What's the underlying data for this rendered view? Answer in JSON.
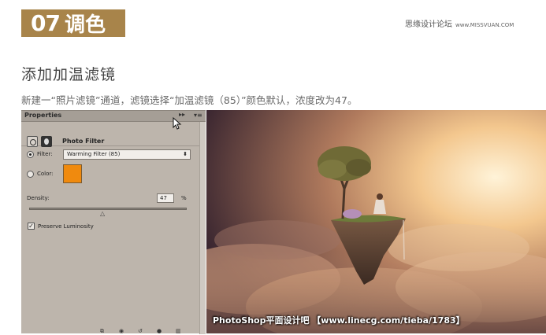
{
  "header": {
    "badge_number": "07",
    "badge_title": "调色",
    "site_name": "思缘设计论坛",
    "site_url": "www.MISSVUAN.COM",
    "badge_color": "#a8844a"
  },
  "section_title": "添加加温滤镜",
  "description": "新建一“照片滤镜”通道，滤镜选择“加温滤镜（85）”颜色默认，浓度改为47。",
  "panel": {
    "tab_label": "Properties",
    "tab_arrows": "▸▸",
    "tab_menu": "▾≡",
    "adjustment_name": "Photo Filter",
    "filter_label": "Filter:",
    "filter_value": "Warming Filter (85)",
    "color_label": "Color:",
    "color_swatch": "#f08a0e",
    "density_label": "Density:",
    "density_value": "47",
    "density_unit": "%",
    "density_level": 0.47,
    "preserve_label": "Preserve Luminosity",
    "preserve_checked": true,
    "filter_radio_selected": true
  },
  "photo": {
    "caption": "PhotoShop平面设计吧 【www.linecg.com/tieba/1783】"
  }
}
